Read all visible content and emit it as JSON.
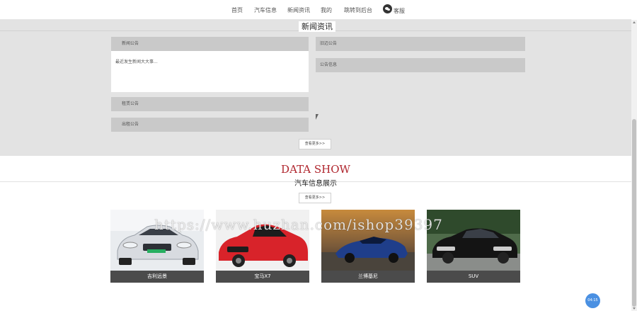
{
  "nav": {
    "home": "首页",
    "car_info": "汽车信息",
    "news": "新闻资讯",
    "mine": "我的",
    "admin": "跳转到后台",
    "service": "客服"
  },
  "news_section": {
    "title": "新闻资讯",
    "notice_main": "新闻公告",
    "notice_text": "最近发生新闻大大事...",
    "notice_right_1": "旧迈公告",
    "notice_right_2": "公告信息",
    "notice_left_3": "租赁公告",
    "notice_left_4": "出租公告",
    "more_label": "查看更多>>"
  },
  "data_show": {
    "title": "DATA SHOW",
    "subtitle": "汽车信息展示",
    "more_label": "查看更多>>"
  },
  "cars": [
    {
      "name": "吉利远景"
    },
    {
      "name": "宝马X7"
    },
    {
      "name": "兰博基尼"
    },
    {
      "name": "SUV"
    }
  ],
  "watermark": "https://www.huzhan.com/ishop39397",
  "badge": "04:15",
  "colors": {
    "accent_red": "#b0262e",
    "card_label_bg": "#4b4b4b",
    "news_bg": "#e3e3e3",
    "badge_blue": "#4a90e2"
  }
}
